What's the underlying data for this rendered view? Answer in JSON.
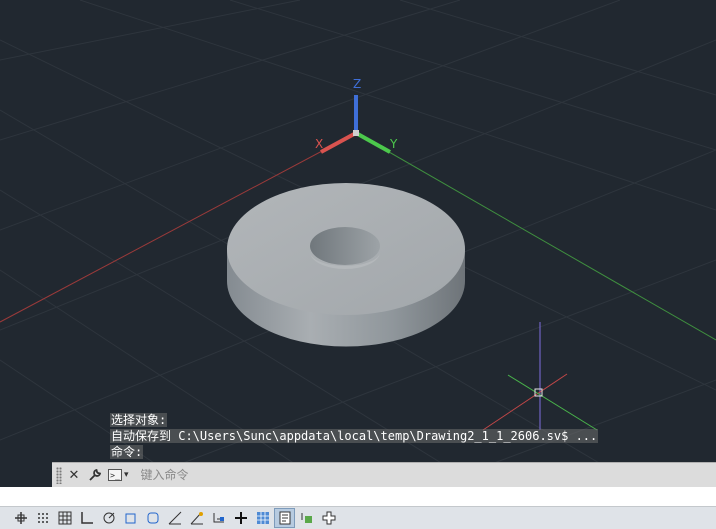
{
  "viewport": {
    "background": "#212830",
    "ucs": {
      "x_label": "X",
      "y_label": "Y",
      "z_label": "Z"
    },
    "colors": {
      "x_axis": "#d9534f",
      "y_axis": "#4cc84c",
      "z_axis": "#3f6fd8"
    }
  },
  "command_history": {
    "line1": "选择对象:",
    "line2": "自动保存到 C:\\Users\\Sunc\\appdata\\local\\temp\\Drawing2_1_1_2606.sv$ ...",
    "line3": "命令:"
  },
  "command_line": {
    "placeholder": "键入命令",
    "close_icon": "close-icon",
    "customize_icon": "wrench-icon",
    "prompt_icon": "command-prompt-icon"
  },
  "status_bar": {
    "buttons": [
      {
        "name": "model-space-icon",
        "active": false
      },
      {
        "name": "snap-icon",
        "active": false
      },
      {
        "name": "grid-icon",
        "active": false
      },
      {
        "name": "ortho-icon",
        "active": false
      },
      {
        "name": "polar-icon",
        "active": false
      },
      {
        "name": "isodraft-icon",
        "active": false
      },
      {
        "name": "object-snap-tracking-icon",
        "active": false
      },
      {
        "name": "object-snap-icon",
        "active": false
      },
      {
        "name": "dynamic-ucs-icon",
        "active": false
      },
      {
        "name": "annotation-visibility-icon",
        "active": false
      },
      {
        "name": "lineweight-icon",
        "active": false
      },
      {
        "name": "dynamic-input-icon",
        "active": false
      },
      {
        "name": "transparency-icon",
        "active": true
      },
      {
        "name": "quick-properties-icon",
        "active": false
      },
      {
        "name": "selection-cycling-icon",
        "active": false
      },
      {
        "name": "customize-icon",
        "active": false
      }
    ]
  }
}
